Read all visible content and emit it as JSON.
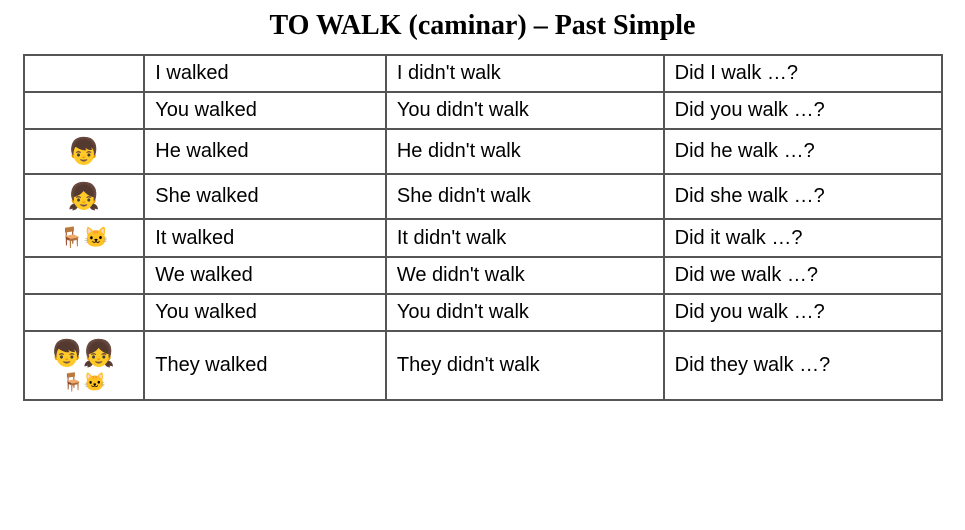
{
  "title": "TO WALK (caminar) – Past Simple",
  "rows": [
    {
      "icon": "",
      "affirmative": "I walked",
      "negative": "I didn't walk",
      "interrogative": "Did I walk …?"
    },
    {
      "icon": "",
      "affirmative": "You walked",
      "negative": "You didn't walk",
      "interrogative": "Did you walk …?"
    },
    {
      "icon": "he",
      "affirmative": "He walked",
      "negative": "He didn't walk",
      "interrogative": "Did he walk …?"
    },
    {
      "icon": "she",
      "affirmative": "She walked",
      "negative": "She didn't walk",
      "interrogative": "Did she walk …?"
    },
    {
      "icon": "it",
      "affirmative": "It walked",
      "negative": "It didn't walk",
      "interrogative": "Did it walk …?"
    },
    {
      "icon": "",
      "affirmative": "We walked",
      "negative": "We didn't walk",
      "interrogative": "Did we walk …?"
    },
    {
      "icon": "",
      "affirmative": "You walked",
      "negative": "You didn't walk",
      "interrogative": "Did you walk …?"
    },
    {
      "icon": "they",
      "affirmative": "They walked",
      "negative": "They didn't walk",
      "interrogative": "Did they walk …?"
    }
  ]
}
